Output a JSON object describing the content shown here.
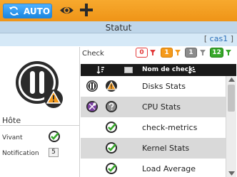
{
  "toolbar": {
    "auto_label": "AUTO",
    "icons": [
      "sync-icon",
      "eye-icon",
      "plus-icon"
    ]
  },
  "header": {
    "title": "Statut",
    "link_prefix": "[ ",
    "link_text": "cas1",
    "link_suffix": " ]"
  },
  "host": {
    "heading": "Hôte",
    "alive_label": "Vivant",
    "alive_icon": "ok-check-icon",
    "notification_label": "Notification",
    "notification_count": "5"
  },
  "checks": {
    "heading": "Check",
    "filters": [
      {
        "count": "0",
        "color": "#e23a3a"
      },
      {
        "count": "1",
        "color": "#f59a1b"
      },
      {
        "count": "1",
        "color": "#8c8c8c"
      },
      {
        "count": "12",
        "color": "#37a82a"
      }
    ],
    "column_name": "Nom de check",
    "rows": [
      {
        "name": "Disks Stats",
        "icons": [
          "paused-icon",
          "warning-icon"
        ]
      },
      {
        "name": "CPU Stats",
        "icons": [
          "tools-icon",
          "unknown-icon"
        ]
      },
      {
        "name": "check-metrics",
        "icons": [
          "ok-check-icon"
        ]
      },
      {
        "name": "Kernel Stats",
        "icons": [
          "ok-check-icon"
        ]
      },
      {
        "name": "Load Average",
        "icons": [
          "ok-check-icon"
        ]
      }
    ]
  },
  "colors": {
    "toolbar": "#f5a025",
    "accent_blue": "#1a86e0",
    "header_bg": "#bfd6e9",
    "ok": "#37a82a",
    "warning": "#f59a1b"
  }
}
